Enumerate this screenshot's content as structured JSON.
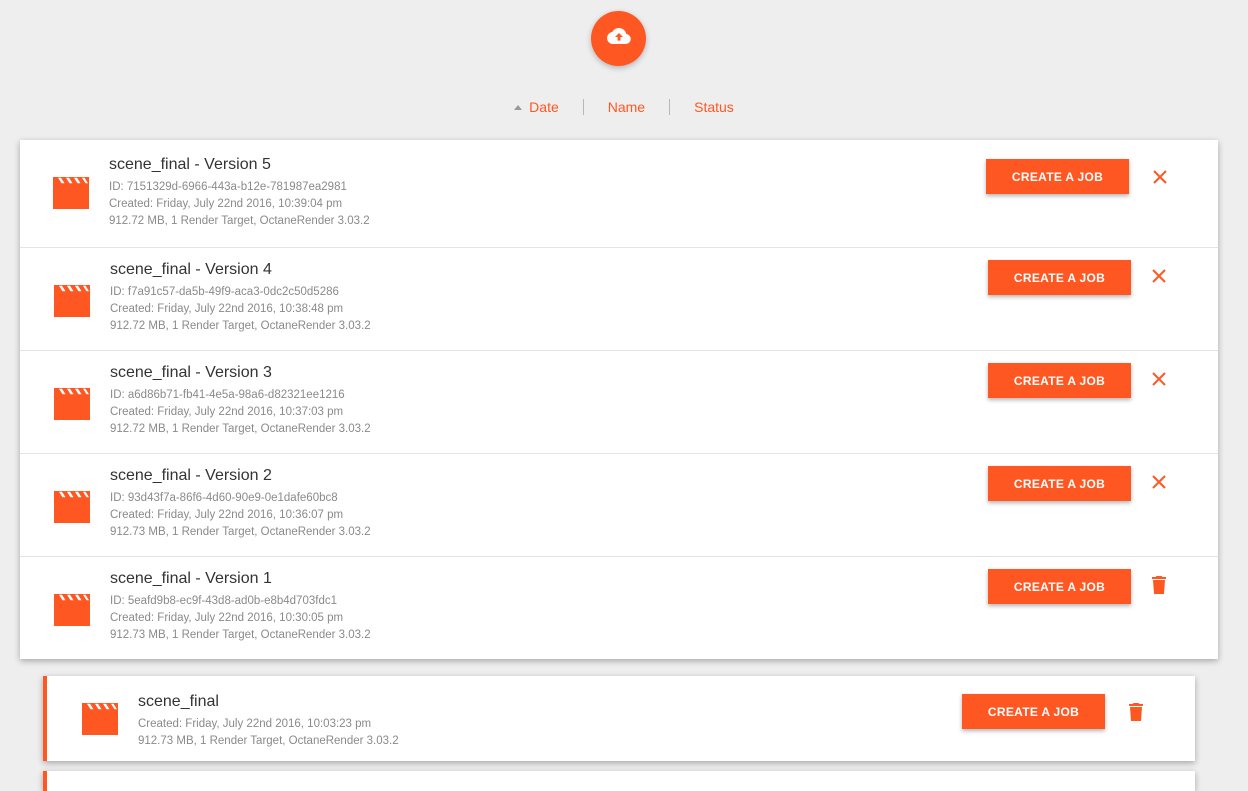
{
  "colors": {
    "accent": "#ff5722",
    "background": "#eeeeee"
  },
  "upload": {
    "icon": "cloud-upload-icon"
  },
  "sort": {
    "items": [
      {
        "label": "Date",
        "active": true,
        "direction": "ascending"
      },
      {
        "label": "Name"
      },
      {
        "label": "Status"
      }
    ]
  },
  "versions": [
    {
      "title": "scene_final - Version 5",
      "id": "ID: 7151329d-6966-443a-b12e-781987ea2981",
      "created": "Created: Friday, July 22nd 2016, 10:39:04 pm",
      "details": "912.72 MB, 1 Render Target, OctaneRender 3.03.2",
      "button": "CREATE A JOB",
      "action_icon": "close-icon"
    },
    {
      "title": "scene_final - Version 4",
      "id": "ID: f7a91c57-da5b-49f9-aca3-0dc2c50d5286",
      "created": "Created: Friday, July 22nd 2016, 10:38:48 pm",
      "details": "912.72 MB, 1 Render Target, OctaneRender 3.03.2",
      "button": "CREATE A JOB",
      "action_icon": "close-icon"
    },
    {
      "title": "scene_final - Version 3",
      "id": "ID: a6d86b71-fb41-4e5a-98a6-d82321ee1216",
      "created": "Created: Friday, July 22nd 2016, 10:37:03 pm",
      "details": "912.72 MB, 1 Render Target, OctaneRender 3.03.2",
      "button": "CREATE A JOB",
      "action_icon": "close-icon"
    },
    {
      "title": "scene_final - Version 2",
      "id": "ID: 93d43f7a-86f6-4d60-90e9-0e1dafe60bc8",
      "created": "Created: Friday, July 22nd 2016, 10:36:07 pm",
      "details": "912.73 MB, 1 Render Target, OctaneRender 3.03.2",
      "button": "CREATE A JOB",
      "action_icon": "close-icon"
    },
    {
      "title": "scene_final - Version 1",
      "id": "ID: 5eafd9b8-ec9f-43d8-ad0b-e8b4d703fdc1",
      "created": "Created: Friday, July 22nd 2016, 10:30:05 pm",
      "details": "912.73 MB, 1 Render Target, OctaneRender 3.03.2",
      "button": "CREATE A JOB",
      "action_icon": "trash-icon"
    }
  ],
  "scene": {
    "title": "scene_final",
    "created": "Created: Friday, July 22nd 2016, 10:03:23 pm",
    "details": "912.73 MB, 1 Render Target, OctaneRender 3.03.2",
    "button": "CREATE A JOB",
    "action_icon": "trash-icon"
  }
}
